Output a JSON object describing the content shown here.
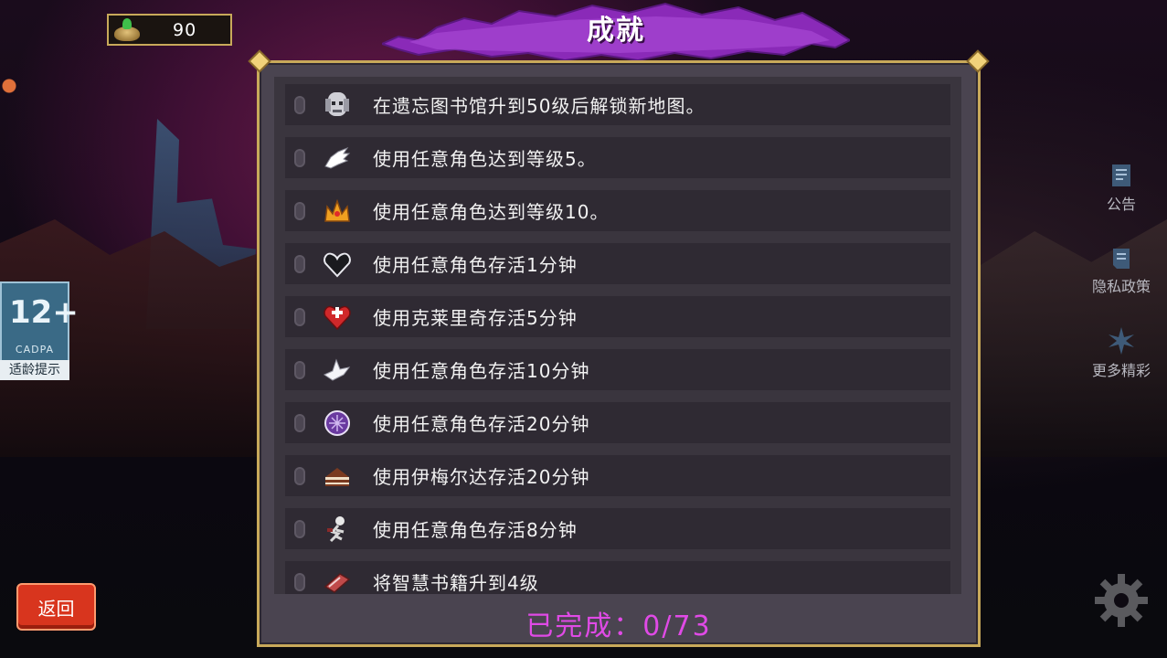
{
  "currency": {
    "amount": "90",
    "icon": "gold-pile-icon"
  },
  "banner": {
    "title": "成就"
  },
  "achievements": [
    {
      "text": "在遗忘图书馆升到50级后解锁新地图。",
      "icon": "skull-statue-icon"
    },
    {
      "text": "使用任意角色达到等级5。",
      "icon": "wings-icon"
    },
    {
      "text": "使用任意角色达到等级10。",
      "icon": "golden-crown-icon"
    },
    {
      "text": "使用任意角色存活1分钟",
      "icon": "dark-heart-icon"
    },
    {
      "text": "使用克莱里奇存活5分钟",
      "icon": "red-heart-cross-icon"
    },
    {
      "text": "使用任意角色存活10分钟",
      "icon": "white-dove-icon"
    },
    {
      "text": "使用任意角色存活20分钟",
      "icon": "purple-orb-icon"
    },
    {
      "text": "使用伊梅尔达存活20分钟",
      "icon": "cake-icon"
    },
    {
      "text": "使用任意角色存活8分钟",
      "icon": "skeleton-icon"
    },
    {
      "text": "将智慧书籍升到4级",
      "icon": "spellbook-icon"
    }
  ],
  "footer": {
    "completed": "已完成：0/73"
  },
  "back_button": {
    "label": "返回"
  },
  "age_rating": {
    "number": "12+",
    "org": "CADPA",
    "tip": "适龄提示"
  },
  "side_menu": {
    "notice": "公告",
    "privacy": "隐私政策",
    "more": "更多精彩"
  },
  "colors": {
    "panel_border": "#c8a95a",
    "completed_text": "#e04ae6",
    "back_button": "#d8351e",
    "banner": "#8a2ab8"
  }
}
